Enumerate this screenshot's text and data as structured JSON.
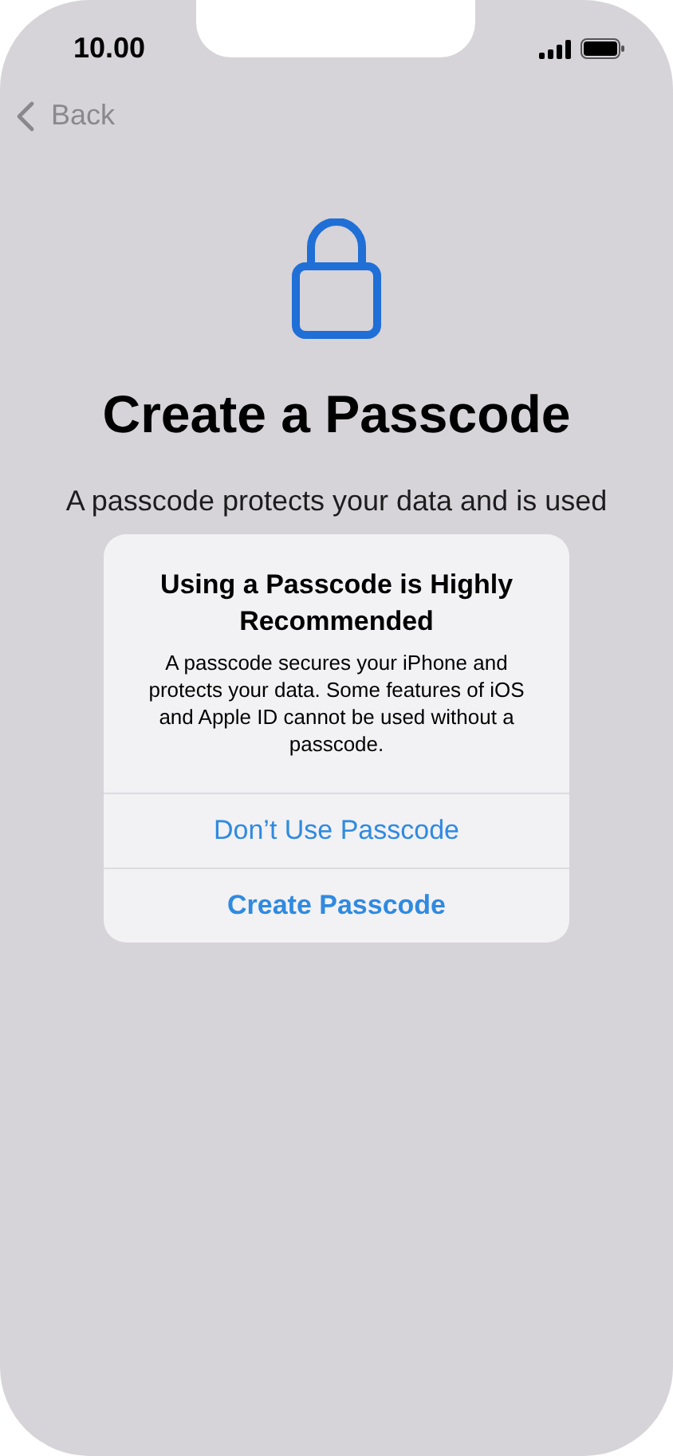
{
  "status_bar": {
    "time": "10.00"
  },
  "nav": {
    "back": "Back"
  },
  "title": "Create a Passcode",
  "description": "A passcode protects your data and is used",
  "alert": {
    "title": "Using a Passcode is Highly Recommended",
    "message": "A passcode secures your iPhone and protects your data. Some features of iOS and Apple ID cannot be used without a passcode.",
    "actions": [
      {
        "label": "Don’t Use Passcode",
        "kind": "default"
      },
      {
        "label": "Create Passcode",
        "kind": "preferred"
      }
    ]
  }
}
